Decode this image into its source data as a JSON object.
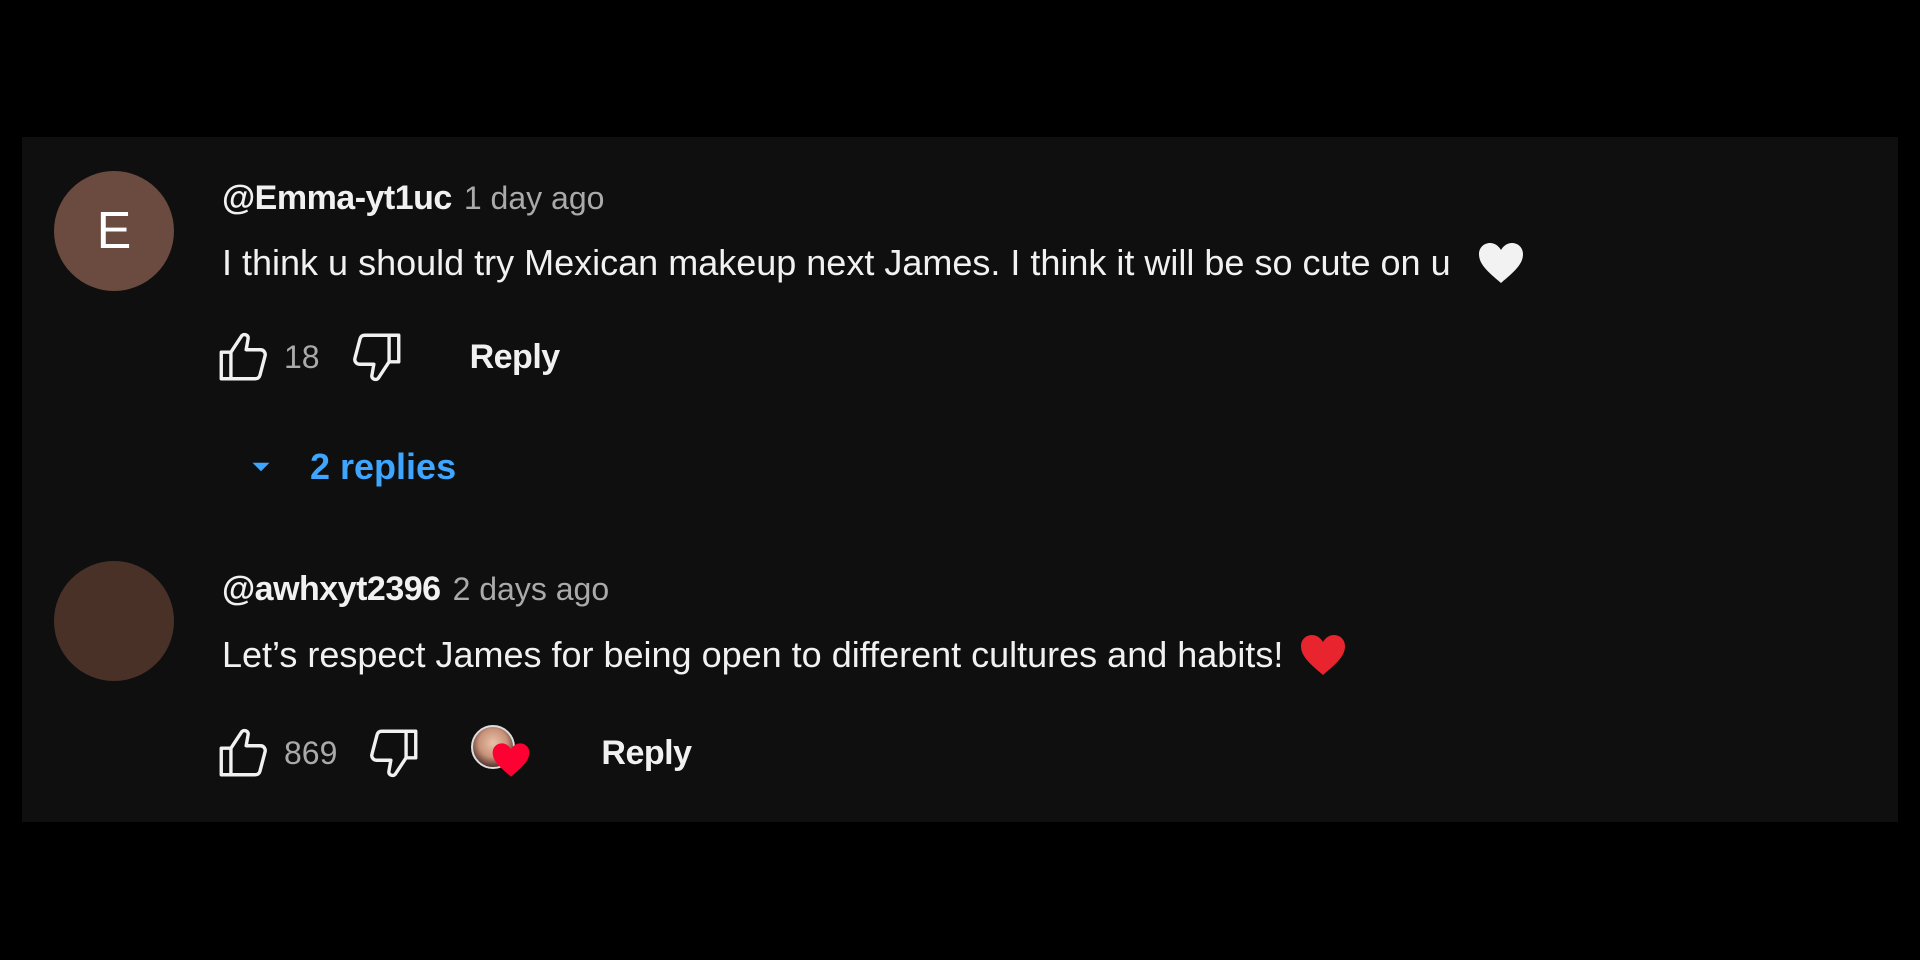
{
  "comments": [
    {
      "avatar_letter": "E",
      "avatar_color": "#6b4a3f",
      "author": "@Emma-yt1uc",
      "time": "1 day ago",
      "text": "I think u should try Mexican makeup next James. I think it will be so cute on u",
      "emoji": "white-heart",
      "likes": "18",
      "reply_label": "Reply",
      "replies_label": "2 replies"
    },
    {
      "avatar_letter": "",
      "avatar_color": "#4a3128",
      "author": "@awhxyt2396",
      "time": "2 days ago",
      "text": "Let’s respect James for being open to different cultures and habits!",
      "emoji": "red-heart",
      "likes": "869",
      "reply_label": "Reply",
      "creator_hearted": true
    }
  ],
  "colors": {
    "background": "#000000",
    "panel": "#0f0f0f",
    "primary_text": "#f1f1f1",
    "secondary_text": "#aaaaaa",
    "link_blue": "#3ea6ff",
    "heart_red": "#ff0033"
  }
}
